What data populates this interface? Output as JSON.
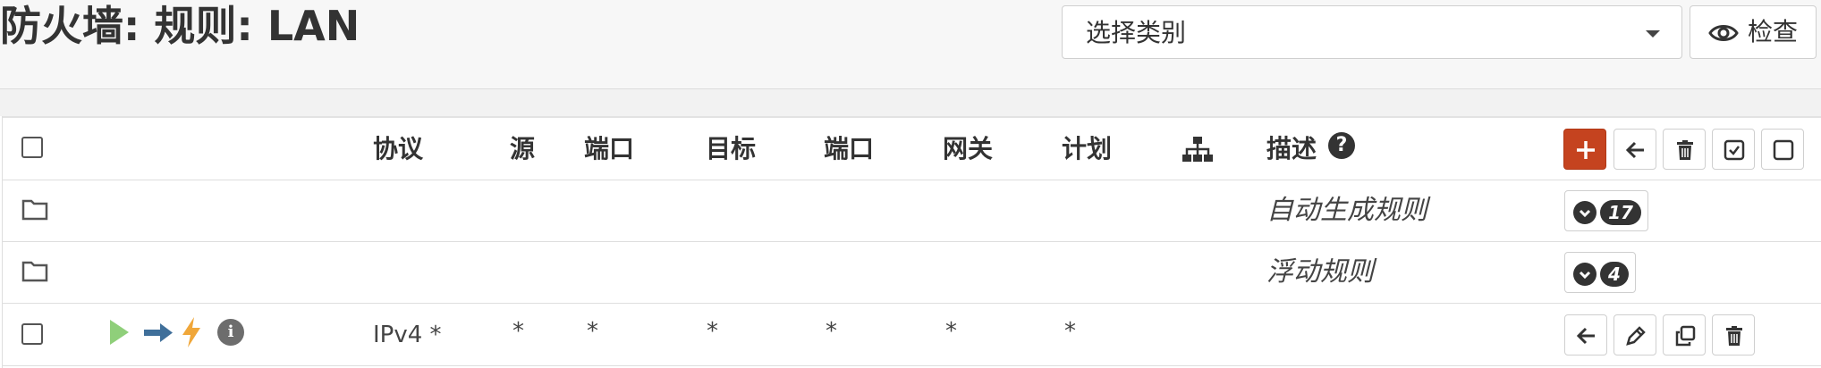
{
  "header": {
    "title": "防火墙: 规则: LAN",
    "category_select": {
      "value": "选择类别"
    },
    "inspect_label": "检查"
  },
  "table": {
    "columns": [
      "协议",
      "源",
      "端口",
      "目标",
      "端口",
      "网关",
      "计划",
      "描述"
    ],
    "groups": [
      {
        "label": "自动生成规则",
        "count": "17"
      },
      {
        "label": "浮动规则",
        "count": "4"
      }
    ],
    "rule": {
      "protocol": "IPv4 *",
      "source": "*",
      "source_port": "*",
      "destination": "*",
      "destination_port": "*",
      "gateway": "*",
      "schedule": "*"
    }
  },
  "icons": {
    "help": "question-icon",
    "info": "info-icon",
    "status_pass": "play-icon",
    "direction": "arrow-right-icon",
    "quick": "bolt-icon"
  },
  "colors": {
    "add_button": "#c5431f",
    "pass_green": "#8fcf7a",
    "direction_blue": "#3f6f9a",
    "quick_orange": "#f0a73a"
  }
}
